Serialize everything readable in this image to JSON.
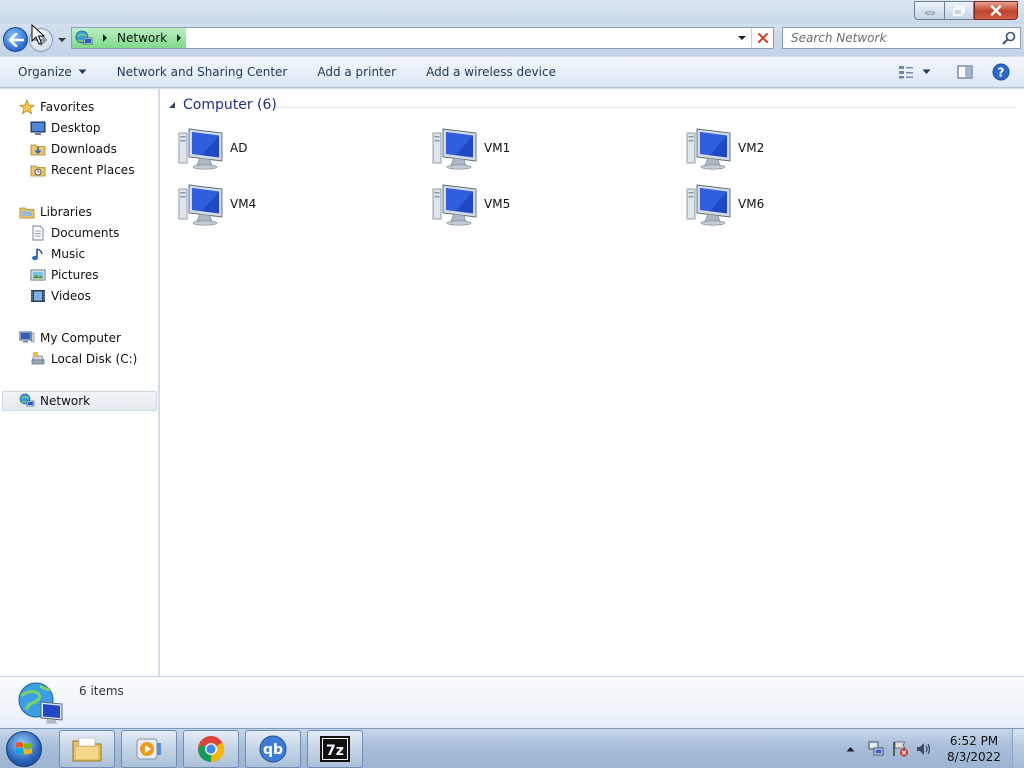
{
  "address_bar": {
    "location_label": "Network",
    "search_placeholder": "Search Network"
  },
  "toolbar": {
    "organize_label": "Organize",
    "network_sharing_label": "Network and Sharing Center",
    "add_printer_label": "Add a printer",
    "add_wireless_label": "Add a wireless device"
  },
  "sidebar": {
    "favorites_label": "Favorites",
    "desktop_label": "Desktop",
    "downloads_label": "Downloads",
    "recent_places_label": "Recent Places",
    "libraries_label": "Libraries",
    "documents_label": "Documents",
    "music_label": "Music",
    "pictures_label": "Pictures",
    "videos_label": "Videos",
    "my_computer_label": "My Computer",
    "local_disk_label": "Local Disk (C:)",
    "network_label": "Network",
    "selected_item": "Network"
  },
  "content": {
    "group_header": "Computer (6)",
    "computers": [
      {
        "name": "AD"
      },
      {
        "name": "VM1"
      },
      {
        "name": "VM2"
      },
      {
        "name": "VM4"
      },
      {
        "name": "VM5"
      },
      {
        "name": "VM6"
      }
    ]
  },
  "details": {
    "item_count": "6 items"
  },
  "taskbar": {
    "apps": [
      "file-explorer",
      "media-player",
      "chrome",
      "qbittorrent",
      "7-zip"
    ],
    "qbittorrent_glyph": "qb",
    "sevenzip_glyph": "7z",
    "time": "6:52 PM",
    "date": "8/3/2022"
  },
  "colors": {
    "accent_blue": "#1e3287",
    "address_highlight": "#7fd98b",
    "close_button": "#c0432a"
  }
}
